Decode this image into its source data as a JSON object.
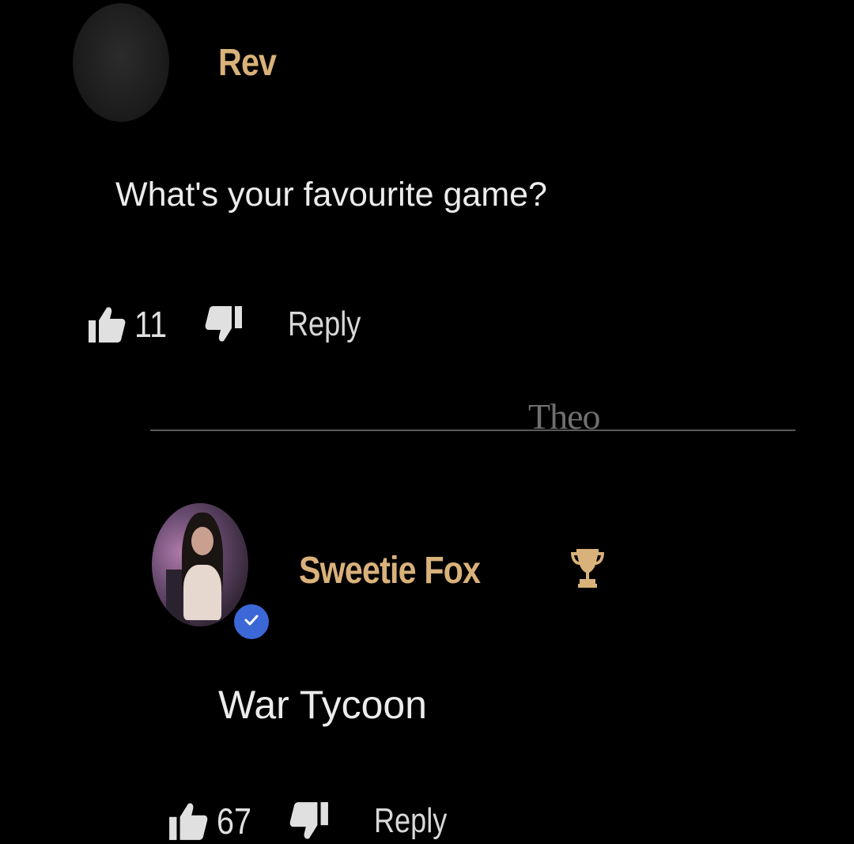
{
  "comments": [
    {
      "author": "Rev",
      "text": "What's your favourite game?",
      "likes": "11",
      "reply_label": "Reply"
    },
    {
      "author": "Sweetie Fox",
      "text": "War Tycoon",
      "likes": "67",
      "reply_label": "Reply",
      "verified": true,
      "badge_icon": "trophy-icon"
    }
  ],
  "divider": {
    "watermark": "Theo"
  },
  "colors": {
    "background": "#000000",
    "author_name": "#d9b27a",
    "verified_badge": "#3c67d6"
  }
}
